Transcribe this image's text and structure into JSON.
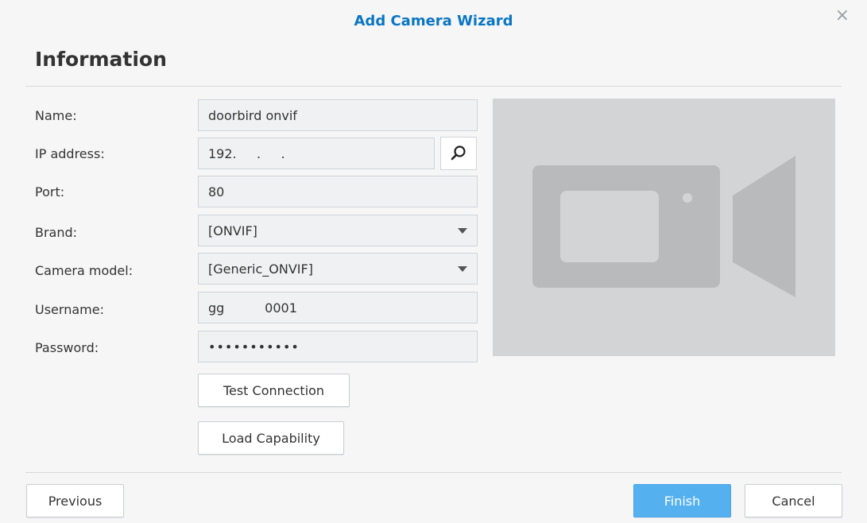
{
  "dialog": {
    "title": "Add Camera Wizard",
    "close_symbol": "×"
  },
  "section": {
    "title": "Information"
  },
  "form": {
    "name": {
      "label": "Name:",
      "value": "doorbird onvif"
    },
    "ip": {
      "label": "IP address:",
      "value": "192.     .     ."
    },
    "port": {
      "label": "Port:",
      "value": "80"
    },
    "brand": {
      "label": "Brand:",
      "value": "[ONVIF]"
    },
    "model": {
      "label": "Camera model:",
      "value": "[Generic_ONVIF]"
    },
    "username": {
      "label": "Username:",
      "value": "gg          0001"
    },
    "password": {
      "label": "Password:",
      "value": "•••••••••••"
    }
  },
  "buttons": {
    "test_connection": "Test Connection",
    "load_capability": "Load Capability",
    "previous": "Previous",
    "finish": "Finish",
    "cancel": "Cancel"
  },
  "icons": {
    "search": "search-icon",
    "camera": "video-camera-icon",
    "dropdown": "chevron-down-icon"
  },
  "colors": {
    "title": "#0a76c4",
    "primary_button": "#55b0f0",
    "preview_bg": "#d3d4d6",
    "camera_glyph": "#b9babc"
  }
}
